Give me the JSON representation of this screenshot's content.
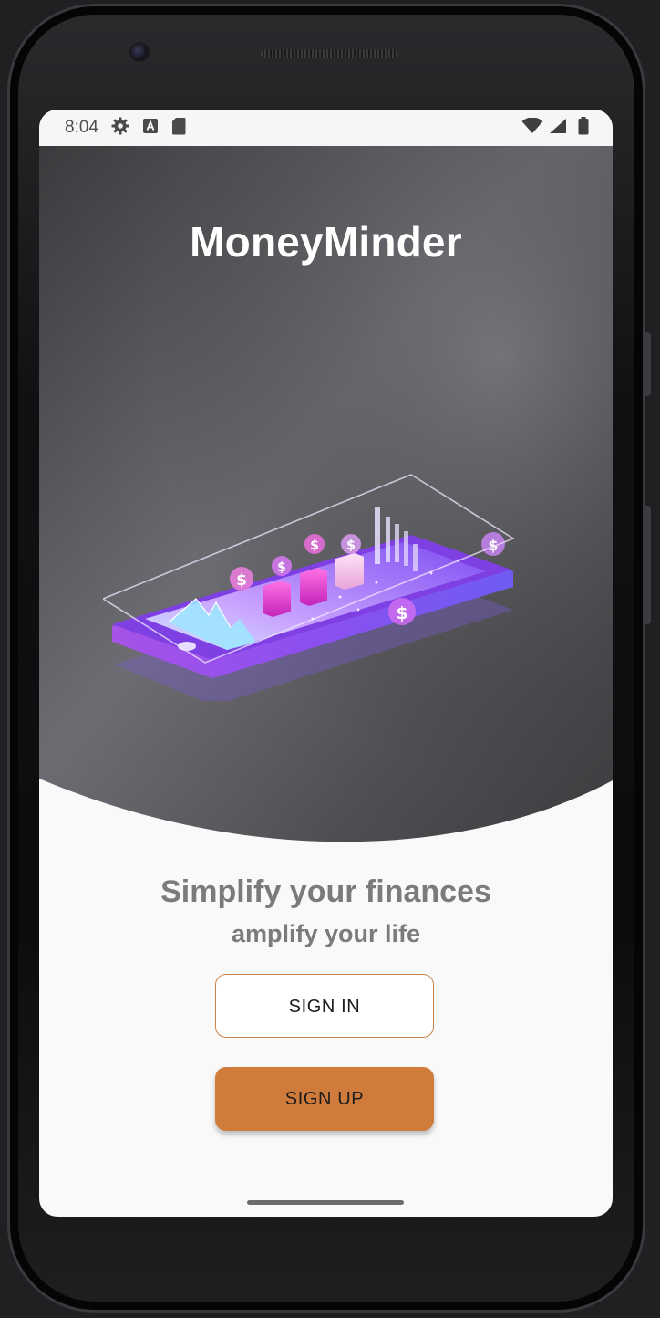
{
  "status_bar": {
    "time": "8:04",
    "icons": [
      "settings-icon",
      "a-badge-icon",
      "sd-card-icon",
      "wifi-icon",
      "signal-icon",
      "battery-icon"
    ]
  },
  "app": {
    "title": "MoneyMinder",
    "illustration": "isometric-phone-finance-illustration"
  },
  "welcome": {
    "tagline": "Simplify your finances",
    "subtagline": "amplify your life"
  },
  "buttons": {
    "sign_in": "SIGN IN",
    "sign_up": "SIGN UP"
  },
  "colors": {
    "accent": "#cf7b3b",
    "hero_dark": "#4a4a4e",
    "illustration_purple": "#8a55f0"
  }
}
